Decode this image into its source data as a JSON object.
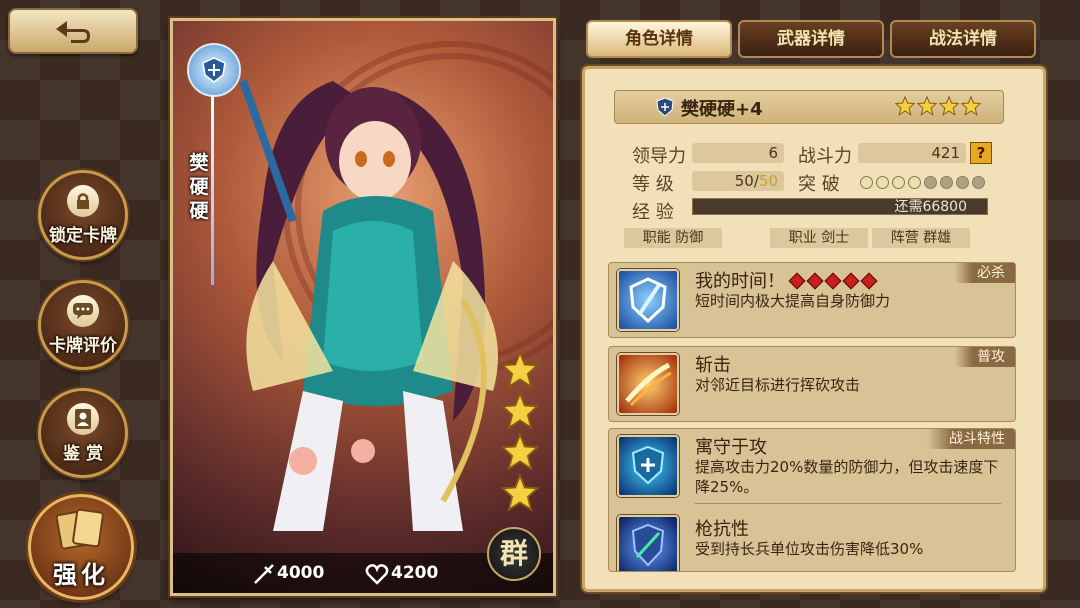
{
  "tabs": [
    {
      "label": "角色详情",
      "active": true
    },
    {
      "label": "武器详情",
      "active": false
    },
    {
      "label": "战法详情",
      "active": false
    }
  ],
  "side_menu": {
    "lock": "锁定卡牌",
    "review": "卡牌评价",
    "appreciate": "鉴 赏",
    "enhance": "强化"
  },
  "card": {
    "vertical_name": "樊硬硬",
    "stars": 4,
    "attack": "4000",
    "health": "4200",
    "faction_glyph": "群"
  },
  "hero": {
    "name": "樊硬硬+4",
    "stars": 4,
    "leadership_label": "领导力",
    "leadership_value": "6",
    "combat_label": "战斗力",
    "combat_value": "421",
    "combat_help": "?",
    "level_label": "等 级",
    "level_current": "50",
    "level_sep": "/",
    "level_max": "50",
    "breakthrough_label": "突 破",
    "breakthrough_filled": 4,
    "breakthrough_total": 8,
    "exp_label": "经 验",
    "exp_text": "还需66800",
    "role_label": "职能",
    "role_value": "防御",
    "job_label": "职业",
    "job_value": "剑士",
    "camp_label": "阵营",
    "camp_value": "群雄"
  },
  "skills": [
    {
      "title": "我的时间！",
      "tag": "必杀",
      "desc": "短时间内极大提高自身防御力",
      "cost_diamonds": 5
    },
    {
      "title": "斩击",
      "tag": "普攻",
      "desc": "对邻近目标进行挥砍攻击"
    },
    {
      "title": "寓守于攻",
      "tag": "战斗特性",
      "desc": "提高攻击力20%数量的防御力，但攻击速度下降25%。"
    },
    {
      "title": "枪抗性",
      "tag": "",
      "desc": "受到持长兵单位攻击伤害降低30%"
    }
  ],
  "colors": {
    "panel_bg": "#f2e0b8",
    "tab_active": "#f4dca0",
    "accent_gold": "#c8a468",
    "diamond_red": "#c8201a"
  }
}
